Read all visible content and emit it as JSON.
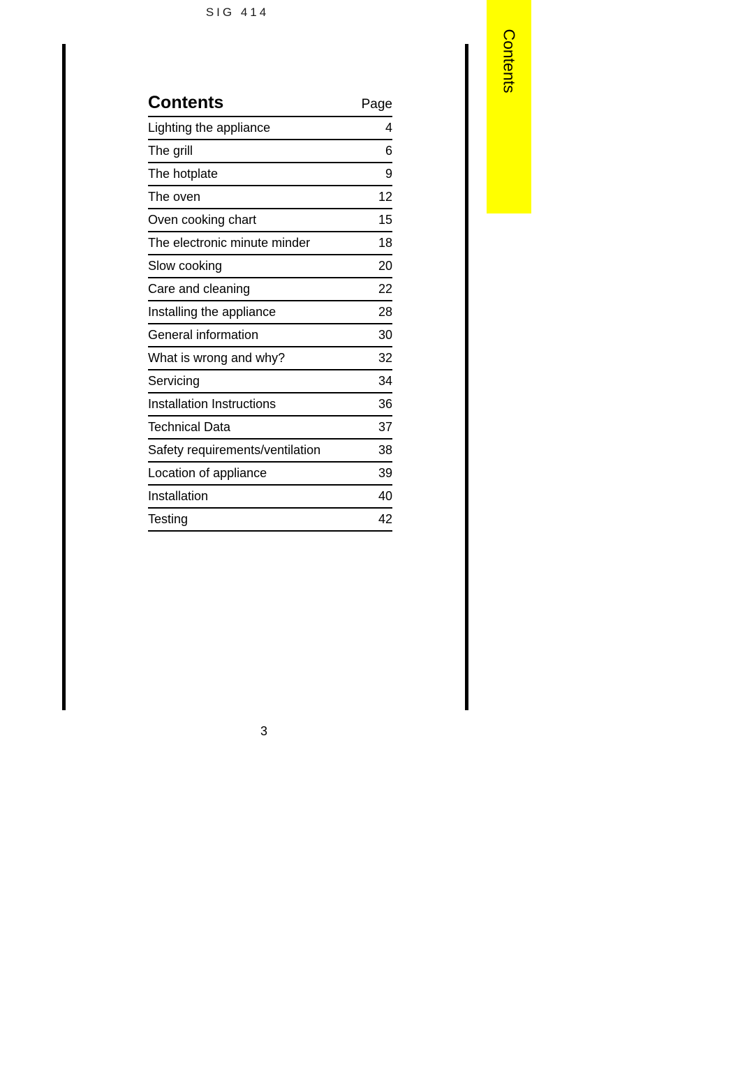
{
  "document": {
    "model_header": "SIG 414",
    "page_number": "3"
  },
  "section_tab": {
    "label": "Contents",
    "color": "#FFFF00"
  },
  "contents": {
    "title": "Contents",
    "page_column_header": "Page",
    "entries": [
      {
        "title": "Lighting the appliance",
        "page": "4"
      },
      {
        "title": "The grill",
        "page": "6"
      },
      {
        "title": "The hotplate",
        "page": "9"
      },
      {
        "title": "The oven",
        "page": "12"
      },
      {
        "title": "Oven cooking chart",
        "page": "15"
      },
      {
        "title": "The electronic minute minder",
        "page": "18"
      },
      {
        "title": "Slow cooking",
        "page": "20"
      },
      {
        "title": "Care and cleaning",
        "page": "22"
      },
      {
        "title": "Installing the appliance",
        "page": "28"
      },
      {
        "title": "General information",
        "page": "30"
      },
      {
        "title": "What is wrong and why?",
        "page": "32"
      },
      {
        "title": "Servicing",
        "page": "34"
      },
      {
        "title": "Installation Instructions",
        "page": "36"
      },
      {
        "title": "Technical Data",
        "page": "37"
      },
      {
        "title": "Safety requirements/ventilation",
        "page": "38"
      },
      {
        "title": "Location of appliance",
        "page": "39"
      },
      {
        "title": "Installation",
        "page": "40"
      },
      {
        "title": "Testing",
        "page": "42"
      }
    ]
  }
}
